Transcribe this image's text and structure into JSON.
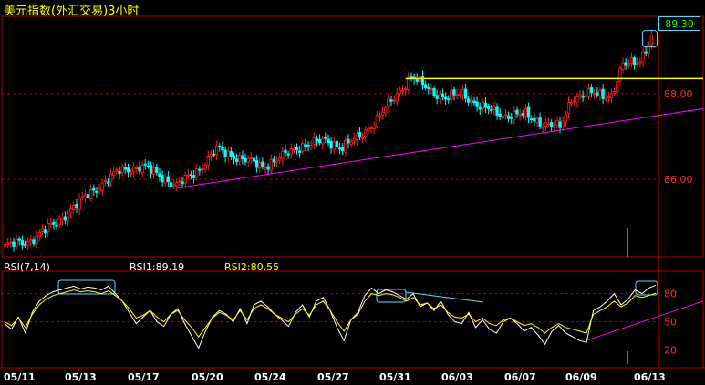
{
  "header": {
    "title": "美元指数(外汇交易)3小时",
    "last_price": "89.30"
  },
  "indicator": {
    "name": "RSI(7,14)",
    "rsi1_label": "RSI1:89.19",
    "rsi2_label": "RSI2:80.55"
  },
  "colors": {
    "background": "#000000",
    "up_candle": "#ff2020",
    "down_candle": "#00ffff",
    "grid": "#b00000",
    "axis_text": "#ff3030",
    "title": "#ffff00",
    "resistance_line": "#ffff00",
    "trend_line": "#ff00ff",
    "rsi1_line": "#ffffff",
    "rsi2_line": "#ffff00",
    "annotation_box": "#5fd7ff"
  },
  "chart_data": [
    {
      "type": "candlestick",
      "title": "美元指数(外汇交易)3小时",
      "y_ticks": [
        "89.30",
        "88.00",
        "86.00"
      ],
      "ylim": [
        84.2,
        89.8
      ],
      "x_ticks": [
        "05/11",
        "05/13",
        "05/17",
        "05/20",
        "05/24",
        "05/27",
        "05/31",
        "06/03",
        "06/07",
        "06/09",
        "06/13"
      ],
      "anchors": [
        {
          "i": 0,
          "v": 84.45
        },
        {
          "i": 8,
          "v": 84.55
        },
        {
          "i": 18,
          "v": 85.0
        },
        {
          "i": 30,
          "v": 85.7
        },
        {
          "i": 40,
          "v": 86.2
        },
        {
          "i": 48,
          "v": 86.3
        },
        {
          "i": 54,
          "v": 86.1
        },
        {
          "i": 60,
          "v": 85.85
        },
        {
          "i": 68,
          "v": 86.25
        },
        {
          "i": 74,
          "v": 86.7
        },
        {
          "i": 82,
          "v": 86.5
        },
        {
          "i": 90,
          "v": 86.3
        },
        {
          "i": 96,
          "v": 86.5
        },
        {
          "i": 104,
          "v": 86.8
        },
        {
          "i": 112,
          "v": 86.9
        },
        {
          "i": 118,
          "v": 86.75
        },
        {
          "i": 124,
          "v": 87.0
        },
        {
          "i": 130,
          "v": 87.4
        },
        {
          "i": 136,
          "v": 87.9
        },
        {
          "i": 142,
          "v": 88.4
        },
        {
          "i": 148,
          "v": 88.1
        },
        {
          "i": 154,
          "v": 87.9
        },
        {
          "i": 160,
          "v": 88.0
        },
        {
          "i": 166,
          "v": 87.7
        },
        {
          "i": 174,
          "v": 87.5
        },
        {
          "i": 182,
          "v": 87.5
        },
        {
          "i": 188,
          "v": 87.3
        },
        {
          "i": 194,
          "v": 87.2
        },
        {
          "i": 198,
          "v": 87.9
        },
        {
          "i": 206,
          "v": 88.0
        },
        {
          "i": 212,
          "v": 87.95
        },
        {
          "i": 216,
          "v": 88.65
        },
        {
          "i": 222,
          "v": 88.8
        },
        {
          "i": 226,
          "v": 89.3
        }
      ],
      "candle_count": 227,
      "resistance_level": 88.35,
      "trend_line": {
        "start": {
          "i": 60,
          "v": 85.8
        },
        "end": {
          "i": 247,
          "v": 87.65
        }
      }
    },
    {
      "type": "line",
      "title": "RSI(7,14)",
      "y_ticks": [
        "80",
        "50",
        "20"
      ],
      "ylim": [
        5,
        100
      ],
      "x_ticks": [
        "05/11",
        "05/13",
        "05/17",
        "05/20",
        "05/24",
        "05/27",
        "05/31",
        "06/03",
        "06/07",
        "06/09",
        "06/13"
      ],
      "series": [
        {
          "name": "RSI1",
          "values": [
            48,
            42,
            55,
            38,
            60,
            72,
            78,
            82,
            84,
            86,
            88,
            85,
            87,
            86,
            84,
            88,
            80,
            72,
            60,
            48,
            55,
            62,
            50,
            45,
            58,
            64,
            48,
            35,
            22,
            40,
            55,
            62,
            58,
            50,
            64,
            48,
            68,
            72,
            66,
            58,
            52,
            45,
            60,
            68,
            55,
            72,
            76,
            62,
            44,
            30,
            52,
            60,
            78,
            86,
            80,
            84,
            82,
            78,
            74,
            80,
            66,
            70,
            62,
            72,
            58,
            50,
            48,
            60,
            44,
            52,
            42,
            38,
            50,
            54,
            48,
            40,
            44,
            36,
            26,
            40,
            46,
            38,
            34,
            30,
            28,
            62,
            66,
            72,
            80,
            68,
            74,
            84,
            80,
            86,
            89
          ]
        },
        {
          "name": "RSI2",
          "values": [
            50,
            46,
            54,
            44,
            58,
            68,
            74,
            78,
            80,
            82,
            84,
            82,
            83,
            82,
            80,
            83,
            78,
            72,
            64,
            54,
            57,
            62,
            55,
            50,
            58,
            62,
            52,
            44,
            34,
            44,
            54,
            60,
            57,
            52,
            62,
            52,
            64,
            68,
            64,
            58,
            54,
            50,
            58,
            64,
            57,
            68,
            72,
            62,
            50,
            40,
            52,
            58,
            72,
            80,
            78,
            80,
            79,
            76,
            72,
            76,
            68,
            70,
            64,
            68,
            60,
            55,
            54,
            58,
            50,
            54,
            48,
            46,
            52,
            54,
            50,
            46,
            48,
            44,
            38,
            44,
            48,
            44,
            42,
            40,
            38,
            58,
            62,
            66,
            72,
            66,
            70,
            78,
            76,
            78,
            80.55
          ]
        }
      ],
      "trend_line": {
        "start": {
          "i": 84,
          "v": 30
        },
        "end": {
          "i": 96,
          "v": 62
        }
      }
    }
  ]
}
